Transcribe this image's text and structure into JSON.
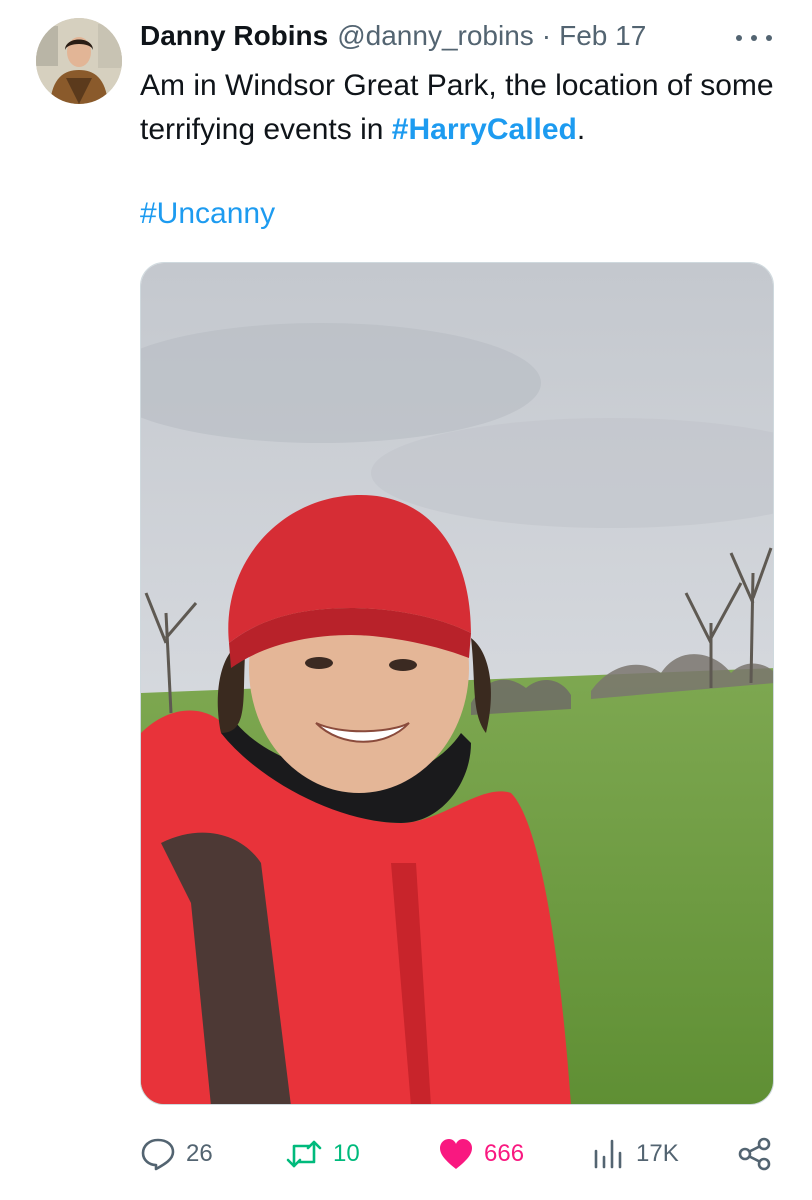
{
  "author": {
    "display_name": "Danny Robins",
    "handle": "@danny_robins",
    "separator": "·",
    "date": "Feb 17",
    "avatar_icon": "profile-photo"
  },
  "tweet": {
    "text_before": "Am in Windsor Great Park, the location of some terrifying events in ",
    "hashtag_1": "#HarryCalled",
    "text_after": ".",
    "hashtag_2": "#Uncanny"
  },
  "photo": {
    "icon": "selfie-photo"
  },
  "actions": {
    "replies": "26",
    "retweets": "10",
    "likes": "666",
    "views": "17K",
    "reply_icon": "speech-bubble-icon",
    "retweet_icon": "retweet-icon",
    "like_icon": "heart-icon",
    "views_icon": "bar-chart-icon",
    "share_icon": "share-icon"
  },
  "colors": {
    "link": "#1d9bf0",
    "retweet": "#00ba7c",
    "like": "#f91880",
    "muted": "#536471"
  }
}
